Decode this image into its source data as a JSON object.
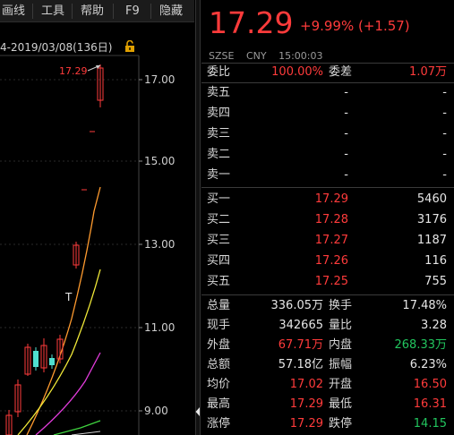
{
  "menu": {
    "items": [
      "画线",
      "工具",
      "帮助",
      "F9",
      "隐藏"
    ]
  },
  "chart": {
    "header": "4-2019/03/08(136日)",
    "price_labels": [
      "17.00",
      "15.00",
      "13.00",
      "11.00",
      "9.00"
    ],
    "high_marker": "17.29",
    "limit_marker": "T"
  },
  "quote": {
    "price": "17.29",
    "change": "+9.99% (+1.57)",
    "exchange": "SZSE",
    "currency": "CNY",
    "time": "15:00:03",
    "weibi_label": "委比",
    "weibi_value": "100.00%",
    "weicha_label": "委差",
    "weicha_value": "1.07万",
    "asks": [
      {
        "label": "卖五",
        "price": "-",
        "vol": "-"
      },
      {
        "label": "卖四",
        "price": "-",
        "vol": "-"
      },
      {
        "label": "卖三",
        "price": "-",
        "vol": "-"
      },
      {
        "label": "卖二",
        "price": "-",
        "vol": "-"
      },
      {
        "label": "卖一",
        "price": "-",
        "vol": "-"
      }
    ],
    "bids": [
      {
        "label": "买一",
        "price": "17.29",
        "vol": "5460"
      },
      {
        "label": "买二",
        "price": "17.28",
        "vol": "3176"
      },
      {
        "label": "买三",
        "price": "17.27",
        "vol": "1187"
      },
      {
        "label": "买四",
        "price": "17.26",
        "vol": "116"
      },
      {
        "label": "买五",
        "price": "17.25",
        "vol": "755"
      }
    ],
    "stats": [
      {
        "l1": "总量",
        "v1": "336.05万",
        "l2": "换手",
        "v2": "17.48%"
      },
      {
        "l1": "现手",
        "v1": "342665",
        "l2": "量比",
        "v2": "3.28"
      },
      {
        "l1": "外盘",
        "v1": "67.71万",
        "l2": "内盘",
        "v2": "268.33万"
      },
      {
        "l1": "总额",
        "v1": "57.18亿",
        "l2": "振幅",
        "v2": "6.23%"
      },
      {
        "l1": "均价",
        "v1": "17.02",
        "l2": "开盘",
        "v2": "16.50"
      },
      {
        "l1": "最高",
        "v1": "17.29",
        "l2": "最低",
        "v2": "16.31"
      },
      {
        "l1": "涨停",
        "v1": "17.29",
        "l2": "跌停",
        "v2": "14.15"
      }
    ]
  },
  "colors": {
    "up": "#ff3b3b",
    "down": "#22c55e",
    "teal": "#4fe0d0"
  }
}
